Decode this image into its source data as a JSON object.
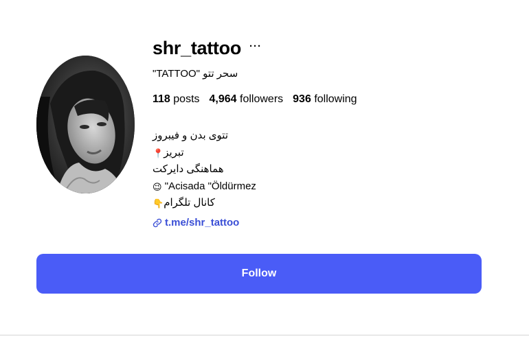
{
  "profile": {
    "username": "shr_tattoo",
    "more_icon": "···",
    "full_name": "سحر تتو \"TATTOO\"",
    "stats": [
      {
        "count": "118",
        "label": "posts"
      },
      {
        "count": "4,964",
        "label": "followers"
      },
      {
        "count": "936",
        "label": "following"
      }
    ],
    "bio_lines": [
      {
        "emoji": "",
        "text": "تتوی بدن و فیبروز"
      },
      {
        "emoji": "📍",
        "text": "تبریز"
      },
      {
        "emoji": "",
        "text": "هماهنگی دایرکت"
      },
      {
        "emoji": "😉",
        "text": "\"Acisada \"Öldürmez"
      },
      {
        "emoji": "👇",
        "text": "کانال تلگرام"
      }
    ],
    "link": "t.me/shr_tattoo",
    "follow_label": "Follow"
  },
  "icons": {
    "avatar": "profile-photo",
    "more": "ellipsis-icon",
    "link": "link-chain-icon"
  },
  "colors": {
    "accent": "#4a5cf7",
    "link": "#3b4fd6",
    "text": "#000000",
    "background": "#ffffff"
  }
}
